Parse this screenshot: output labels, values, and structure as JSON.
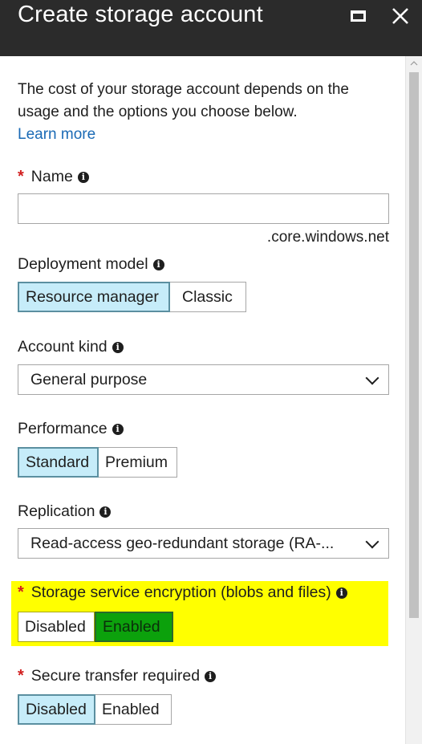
{
  "window": {
    "title": "Create storage account"
  },
  "intro": {
    "text": "The cost of your storage account depends on the usage and the options you choose below.",
    "learn_more": "Learn more"
  },
  "name_field": {
    "label": "Name",
    "value": "",
    "placeholder": "",
    "suffix": ".core.windows.net",
    "required": true
  },
  "deployment_model": {
    "label": "Deployment model",
    "options": [
      "Resource manager",
      "Classic"
    ],
    "selected": "Resource manager"
  },
  "account_kind": {
    "label": "Account kind",
    "value": "General purpose"
  },
  "performance": {
    "label": "Performance",
    "options": [
      "Standard",
      "Premium"
    ],
    "selected": "Standard"
  },
  "replication": {
    "label": "Replication",
    "value": "Read-access geo-redundant storage (RA-..."
  },
  "encryption": {
    "label": "Storage service encryption (blobs and files)",
    "required": true,
    "options": [
      "Disabled",
      "Enabled"
    ],
    "selected": "Enabled",
    "highlight_color": "#ffff00",
    "selected_color": "#0ca10c"
  },
  "secure_transfer": {
    "label": "Secure transfer required",
    "required": true,
    "options": [
      "Disabled",
      "Enabled"
    ],
    "selected": "Disabled"
  },
  "icons": {
    "maximize": "maximize-icon",
    "close": "close-icon",
    "info": "info-icon",
    "dropdown": "chevron-down-icon",
    "required": "asterisk"
  },
  "colors": {
    "titlebar": "#2b2b2b",
    "link": "#1a6ab5",
    "selected_option": "#c6ecf9",
    "required_marker": "#d11f1f"
  }
}
